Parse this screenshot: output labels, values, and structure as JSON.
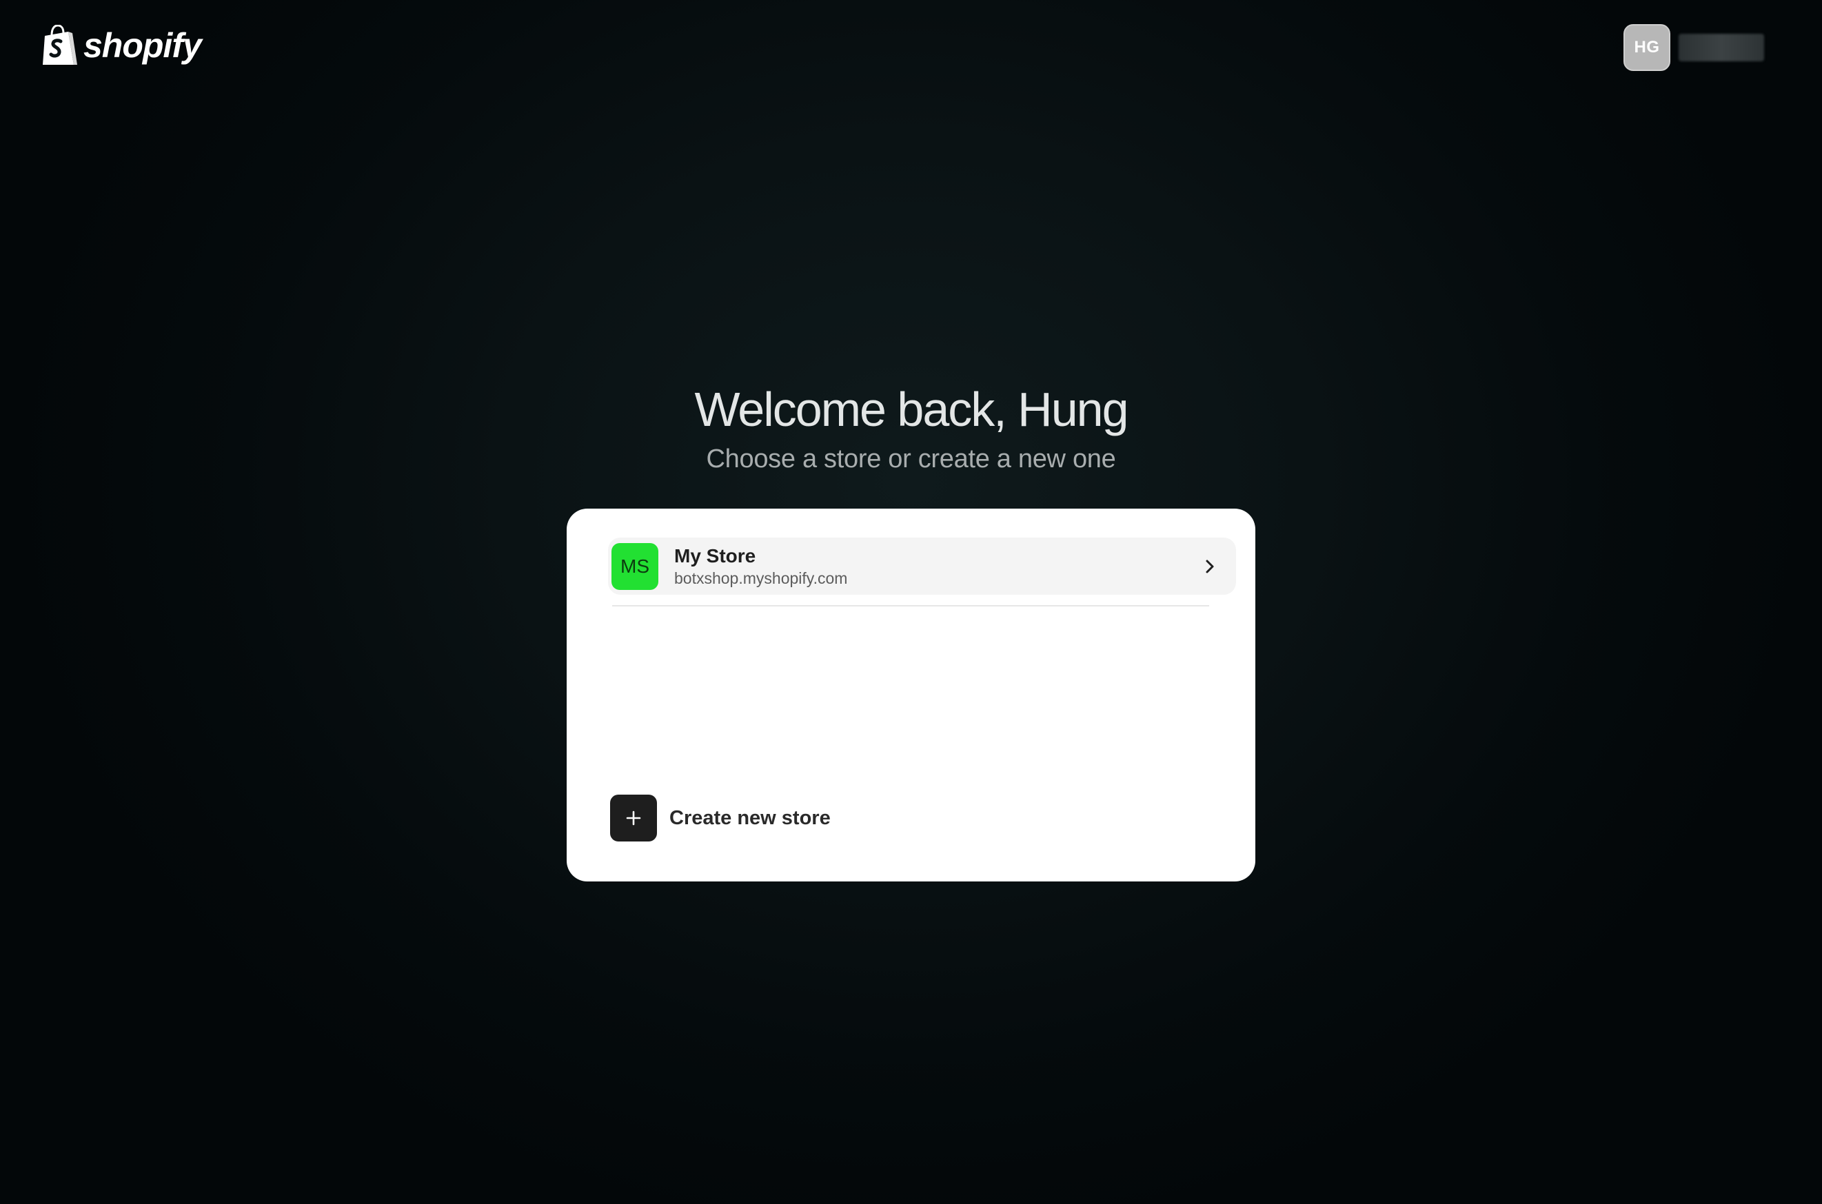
{
  "header": {
    "logo_text": "shopify",
    "account": {
      "initials": "HG"
    }
  },
  "main": {
    "title": "Welcome back, Hung",
    "subtitle": "Choose a store or create a new one"
  },
  "stores": [
    {
      "initials": "MS",
      "name": "My Store",
      "domain": "botxshop.myshopify.com",
      "avatar_color": "#22e032"
    }
  ],
  "create_store": {
    "label": "Create new store",
    "icon": "plus-icon"
  },
  "colors": {
    "background": "#0a1214",
    "card": "#ffffff",
    "store_avatar": "#22e032",
    "account_avatar": "#b7b7b7"
  }
}
